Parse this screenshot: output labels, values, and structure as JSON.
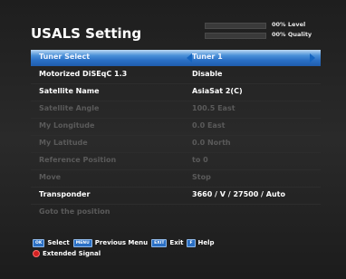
{
  "title": "USALS Setting",
  "meters": {
    "level": {
      "value": 0,
      "label": "00% Level"
    },
    "quality": {
      "value": 0,
      "label": "00% Quality"
    }
  },
  "menu": {
    "tuner_select": {
      "label": "Tuner Select",
      "value": "Tuner 1"
    },
    "motorized": {
      "label": "Motorized DiSEqC 1.3",
      "value": "Disable"
    },
    "satellite_name": {
      "label": "Satellite Name",
      "value": "AsiaSat 2(C)"
    },
    "satellite_angle": {
      "label": "Satellite Angle",
      "value": "100.5 East"
    },
    "my_longitude": {
      "label": "My Longitude",
      "value": "0.0 East"
    },
    "my_latitude": {
      "label": "My Latitude",
      "value": "0.0 North"
    },
    "reference_position": {
      "label": "Reference Position",
      "value": "to 0"
    },
    "move": {
      "label": "Move",
      "value": "Stop"
    },
    "transponder": {
      "label": "Transponder",
      "value": "3660 / V / 27500 / Auto"
    },
    "goto_position": {
      "label": "Goto the position"
    }
  },
  "footer": {
    "ok_key": "OK",
    "select": "Select",
    "menu_key": "MENU",
    "previous_menu": "Previous Menu",
    "exit_key": "EXIT",
    "exit": "Exit",
    "help_key": "F",
    "help": "Help",
    "extended_signal": "Extended Signal"
  },
  "colors": {
    "highlight": "#2a6fc4",
    "enabled_text": "#ffffff",
    "disabled_text": "#5a5a5a",
    "red_key": "#d32020"
  }
}
